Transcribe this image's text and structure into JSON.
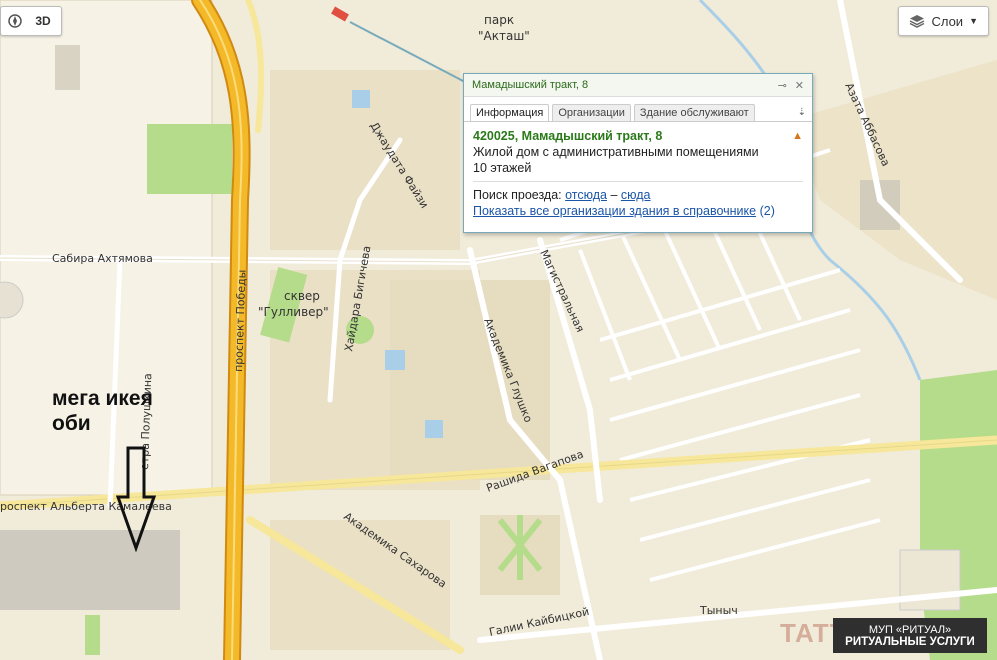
{
  "map": {
    "streets": {
      "sabira": "Сабира Ахтямова",
      "pobedy": "проспект Победы",
      "polushkina": "етра Полушкина",
      "dzhaudata": "Джаудата Файзи",
      "haidara": "Хайдара Бигичева",
      "glushko": "Академика Глушко",
      "magistralnaya": "Магистральная",
      "vagapova": "Рашида Вагапова",
      "kamaleeva": "роспект Альберта Камалеева",
      "saharova": "Академика Сахарова",
      "kaibitskoi": "Галии Кайбицкой",
      "tynych": "Тыныч",
      "abbasova": "Азата Аббасова"
    },
    "pois": {
      "park_line1": "парк",
      "park_line2": "\"Акташ\"",
      "skver_line1": "сквер",
      "skver_line2": "\"Гулливер\""
    }
  },
  "controls": {
    "compass_icon": "compass-icon",
    "mode_3d": "3D",
    "layers_label": "Слои"
  },
  "popup": {
    "title": "Мамадышский тракт, 8",
    "tabs": [
      "Информация",
      "Организации",
      "Здание обслуживают"
    ],
    "active_tab": 0,
    "address": "420025, Мамадышский тракт, 8",
    "description": "Жилой дом с административными помещениями",
    "floors": "10 этажей",
    "route_prefix": "Поиск проезда:",
    "route_from": "отсюда",
    "route_dash": "–",
    "route_to": "сюда",
    "show_all": "Показать все организации здания в справочнике",
    "show_all_count": "(2)"
  },
  "annotation": {
    "line1": "мега икея",
    "line2": "оби"
  },
  "ad": {
    "line1": "МУП «РИТУАЛ»",
    "line2": "РИТУАЛЬНЫЕ УСЛУГИ"
  },
  "watermark": "TATT",
  "colors": {
    "land": "#f1ebd9",
    "highway": "#f4b928",
    "highway_edge": "#d08a10",
    "major_road": "#f7e79a",
    "block": "#e9e0c6",
    "green": "#b5dc8a",
    "water": "#a9cfe8",
    "popup_title": "#2a7a1a",
    "link": "#1a55a8",
    "ad_bg": "#2f2f2f"
  }
}
